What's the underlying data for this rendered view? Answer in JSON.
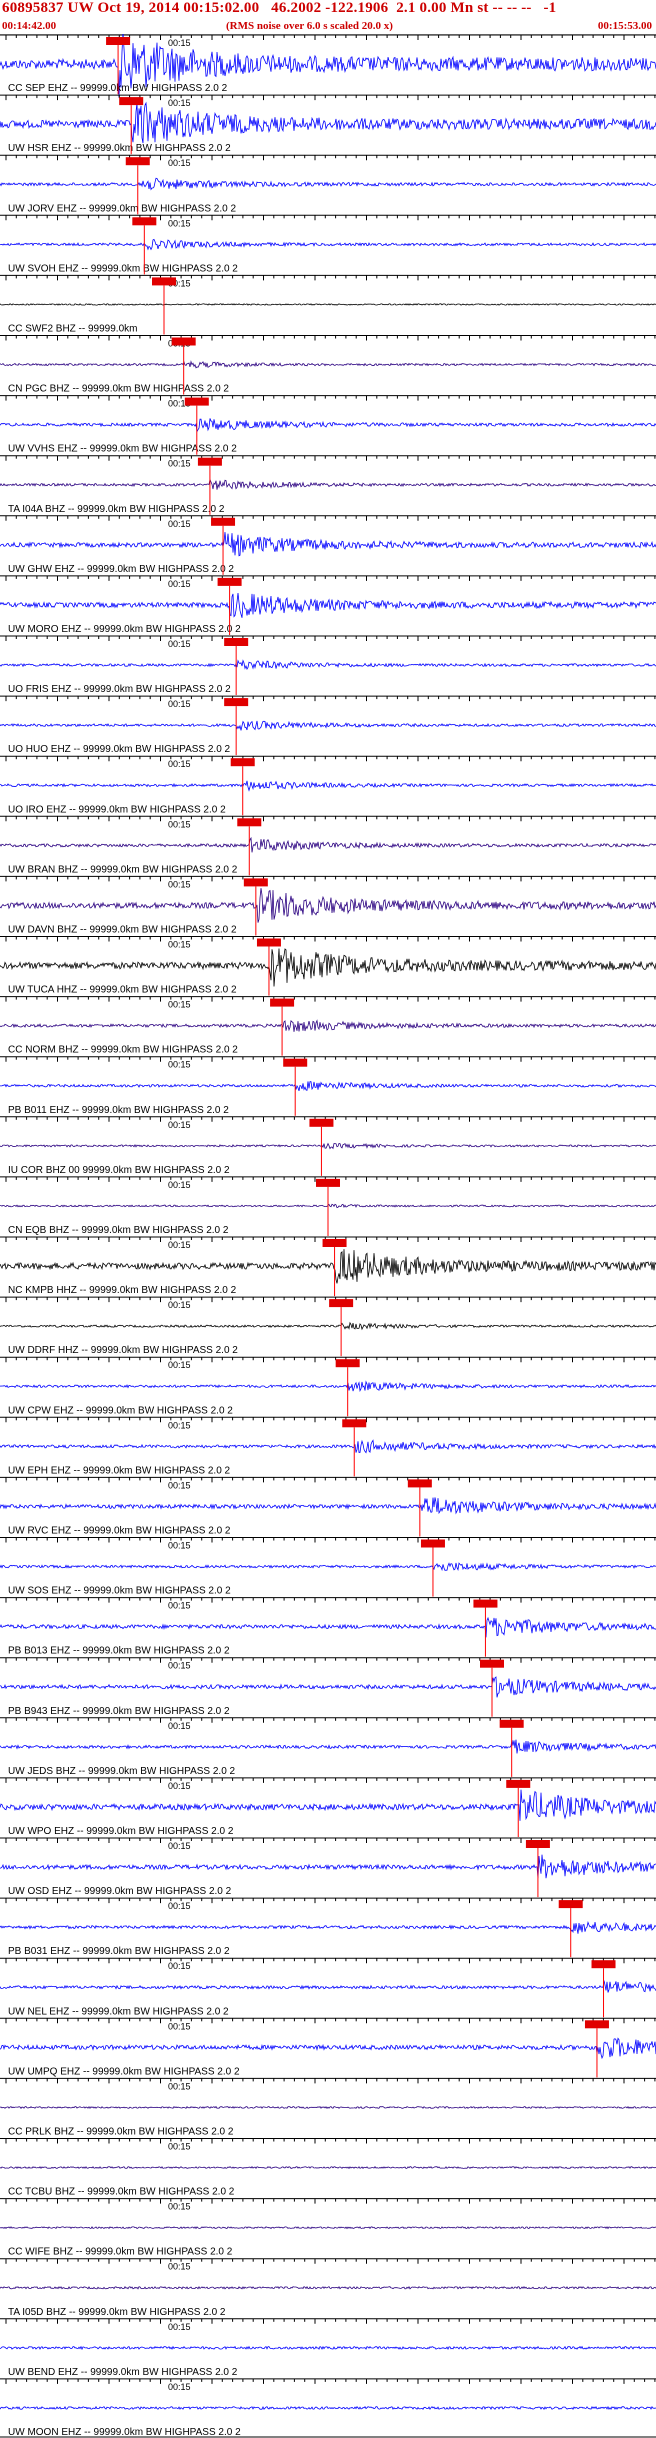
{
  "header": {
    "title": "60895837 UW Oct 19, 2014 00:15:02.00   46.2002 -122.1906  2.1 0.00 Mn st -- -- --   -1",
    "start_time": "00:14:42.00",
    "note": "(RMS noise over 6.0 s scaled 20.0 x)",
    "end_time": "00:15:53.00"
  },
  "time_mark": "00:15",
  "colors": {
    "blue": "#0000ff",
    "purple": "#2a0080",
    "black": "#000000",
    "pick_red": "#e00000",
    "pick_line": "#ff0000",
    "title_red": "#cc0000"
  },
  "traces": [
    {
      "label": "CC SEP EHZ -- 99999.0km BW  HIGHPASS  2.0  2",
      "color": "blue",
      "amp": 0.9,
      "pick": 0.18
    },
    {
      "label": "UW HSR EHZ -- 99999.0km BW  HIGHPASS  2.0  2",
      "color": "blue",
      "amp": 0.7,
      "pick": 0.2
    },
    {
      "label": "UW JORV EHZ -- 99999.0km BW  HIGHPASS  2.0  2",
      "color": "blue",
      "amp": 0.2,
      "pick": 0.21
    },
    {
      "label": "UW SVOH EHZ -- 99999.0km BW  HIGHPASS  2.0  2",
      "color": "blue",
      "amp": 0.15,
      "pick": 0.22
    },
    {
      "label": "CC SWF2 BHZ -- 99999.0km",
      "color": "black",
      "amp": 0.02,
      "pick": 0.25
    },
    {
      "label": "CN PGC BHZ -- 99999.0km BW  HIGHPASS  2.0  2",
      "color": "purple",
      "amp": 0.1,
      "pick": 0.28
    },
    {
      "label": "UW VVHS EHZ -- 99999.0km BW  HIGHPASS  2.0  2",
      "color": "blue",
      "amp": 0.2,
      "pick": 0.3
    },
    {
      "label": "TA I04A BHZ -- 99999.0km BW  HIGHPASS  2.0  2",
      "color": "purple",
      "amp": 0.15,
      "pick": 0.32
    },
    {
      "label": "UW GHW EHZ -- 99999.0km BW  HIGHPASS  2.0  2",
      "color": "blue",
      "amp": 0.35,
      "pick": 0.34
    },
    {
      "label": "UW MORO EHZ -- 99999.0km BW  HIGHPASS  2.0  2",
      "color": "blue",
      "amp": 0.4,
      "pick": 0.35
    },
    {
      "label": "UO FRIS EHZ -- 99999.0km BW  HIGHPASS  2.0  2",
      "color": "blue",
      "amp": 0.15,
      "pick": 0.36
    },
    {
      "label": "UO HUO EHZ -- 99999.0km BW  HIGHPASS  2.0  2",
      "color": "blue",
      "amp": 0.15,
      "pick": 0.36
    },
    {
      "label": "UO IRO EHZ -- 99999.0km BW  HIGHPASS  2.0  2",
      "color": "blue",
      "amp": 0.15,
      "pick": 0.37
    },
    {
      "label": "UW BRAN BHZ -- 99999.0km BW  HIGHPASS  2.0  2",
      "color": "purple",
      "amp": 0.2,
      "pick": 0.38
    },
    {
      "label": "UW DAVN BHZ -- 99999.0km BW  HIGHPASS  2.0  2",
      "color": "purple",
      "amp": 0.5,
      "pick": 0.39
    },
    {
      "label": "UW TUCA HHZ -- 99999.0km BW  HIGHPASS  2.0  2",
      "color": "black",
      "amp": 0.6,
      "pick": 0.41
    },
    {
      "label": "CC NORM BHZ -- 99999.0km BW  HIGHPASS  2.0  2",
      "color": "purple",
      "amp": 0.2,
      "pick": 0.43
    },
    {
      "label": "PB B011 EHZ -- 99999.0km BW  HIGHPASS  2.0  2",
      "color": "blue",
      "amp": 0.15,
      "pick": 0.45
    },
    {
      "label": "IU COR BHZ 00 99999.0km BW  HIGHPASS  2.0  2",
      "color": "purple",
      "amp": 0.08,
      "pick": 0.49
    },
    {
      "label": "CN EQB BHZ -- 99999.0km BW  HIGHPASS  2.0  2",
      "color": "purple",
      "amp": 0.05,
      "pick": 0.5
    },
    {
      "label": "NC KMPB HHZ -- 99999.0km BW  HIGHPASS  2.0  2",
      "color": "black",
      "amp": 0.55,
      "pick": 0.51
    },
    {
      "label": "UW DDRF HHZ -- 99999.0km BW  HIGHPASS  2.0  2",
      "color": "black",
      "amp": 0.1,
      "pick": 0.52
    },
    {
      "label": "UW CPW EHZ -- 99999.0km BW  HIGHPASS  2.0  2",
      "color": "blue",
      "amp": 0.15,
      "pick": 0.53
    },
    {
      "label": "UW EPH EHZ -- 99999.0km BW  HIGHPASS  2.0  2",
      "color": "blue",
      "amp": 0.2,
      "pick": 0.54
    },
    {
      "label": "UW RVC EHZ -- 99999.0km BW  HIGHPASS  2.0  2",
      "color": "blue",
      "amp": 0.3,
      "pick": 0.64
    },
    {
      "label": "UW SOS EHZ -- 99999.0km BW  HIGHPASS  2.0  2",
      "color": "blue",
      "amp": 0.15,
      "pick": 0.66
    },
    {
      "label": "PB B013 EHZ -- 99999.0km BW  HIGHPASS  2.0  2",
      "color": "blue",
      "amp": 0.3,
      "pick": 0.74
    },
    {
      "label": "PB B943 EHZ -- 99999.0km BW  HIGHPASS  2.0  2",
      "color": "blue",
      "amp": 0.3,
      "pick": 0.75
    },
    {
      "label": "UW JEDS BHZ -- 99999.0km BW  HIGHPASS  2.0  2",
      "color": "blue",
      "amp": 0.2,
      "pick": 0.78
    },
    {
      "label": "UW WPO EHZ -- 99999.0km BW  HIGHPASS  2.0  2",
      "color": "blue",
      "amp": 0.5,
      "pick": 0.79
    },
    {
      "label": "UW OSD EHZ -- 99999.0km BW  HIGHPASS  2.0  2",
      "color": "blue",
      "amp": 0.35,
      "pick": 0.82
    },
    {
      "label": "PB B031 EHZ -- 99999.0km BW  HIGHPASS  2.0  2",
      "color": "blue",
      "amp": 0.2,
      "pick": 0.87
    },
    {
      "label": "UW NEL EHZ -- 99999.0km BW  HIGHPASS  2.0  2",
      "color": "blue",
      "amp": 0.2,
      "pick": 0.92
    },
    {
      "label": "UW UMPQ EHZ -- 99999.0km BW  HIGHPASS  2.0  2",
      "color": "blue",
      "amp": 0.35,
      "pick": 0.91
    },
    {
      "label": "CC PRLK BHZ -- 99999.0km BW  HIGHPASS  2.0  2",
      "color": "purple",
      "amp": 0.05,
      "pick": null
    },
    {
      "label": "CC TCBU BHZ -- 99999.0km BW  HIGHPASS  2.0  2",
      "color": "purple",
      "amp": 0.05,
      "pick": null
    },
    {
      "label": "CC WIFE BHZ -- 99999.0km BW  HIGHPASS  2.0  2",
      "color": "purple",
      "amp": 0.05,
      "pick": null
    },
    {
      "label": "TA I05D BHZ -- 99999.0km BW  HIGHPASS  2.0  2",
      "color": "purple",
      "amp": 0.1,
      "pick": null
    },
    {
      "label": "UW BEND EHZ -- 99999.0km BW  HIGHPASS  2.0  2",
      "color": "blue",
      "amp": 0.15,
      "pick": null
    },
    {
      "label": "UW MOON EHZ -- 99999.0km BW  HIGHPASS  2.0  2",
      "color": "blue",
      "amp": 0.15,
      "pick": null
    }
  ]
}
